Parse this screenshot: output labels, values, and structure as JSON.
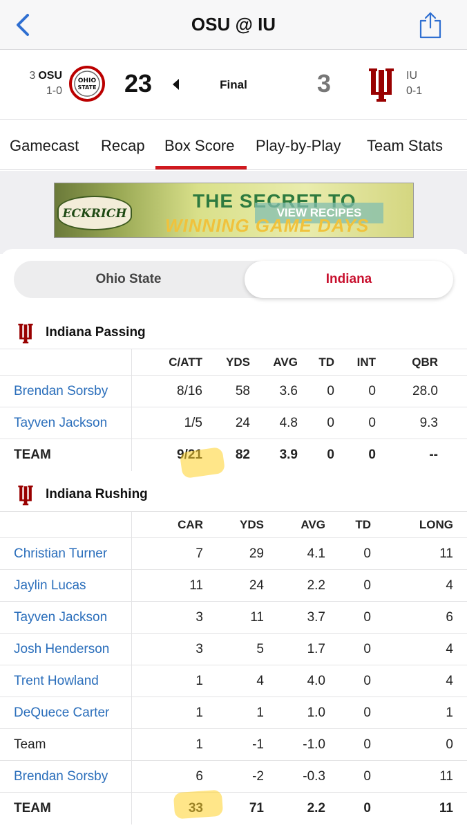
{
  "nav": {
    "title": "OSU @ IU",
    "back_icon": "chevron-left-icon",
    "share_icon": "share-icon"
  },
  "scoreboard": {
    "away": {
      "rank": "3",
      "abbr": "OSU",
      "record": "1-0",
      "score": "23",
      "logo_text": "OHIO STATE"
    },
    "status": "Final",
    "home": {
      "abbr": "IU",
      "record": "0-1",
      "score": "3"
    }
  },
  "tabs": [
    "Gamecast",
    "Recap",
    "Box Score",
    "Play-by-Play",
    "Team Stats"
  ],
  "active_tab": "Box Score",
  "ad": {
    "brand": "ECKRICH",
    "line1": "THE SECRET TO",
    "button": "VIEW RECIPES",
    "line2": "WINNING GAME DAYS"
  },
  "team_toggle": {
    "left": "Ohio State",
    "right": "Indiana",
    "selected": "Indiana"
  },
  "passing": {
    "title": "Indiana Passing",
    "headers": [
      "C/ATT",
      "YDS",
      "AVG",
      "TD",
      "INT",
      "QBR"
    ],
    "rows": [
      {
        "name": "Brendan Sorsby",
        "cells": [
          "8/16",
          "58",
          "3.6",
          "0",
          "0",
          "28.0"
        ]
      },
      {
        "name": "Tayven Jackson",
        "cells": [
          "1/5",
          "24",
          "4.8",
          "0",
          "0",
          "9.3"
        ]
      }
    ],
    "team": {
      "name": "TEAM",
      "cells": [
        "9/21",
        "82",
        "3.9",
        "0",
        "0",
        "--"
      ]
    }
  },
  "rushing": {
    "title": "Indiana Rushing",
    "headers": [
      "CAR",
      "YDS",
      "AVG",
      "TD",
      "LONG"
    ],
    "rows": [
      {
        "name": "Christian Turner",
        "cells": [
          "7",
          "29",
          "4.1",
          "0",
          "11"
        ]
      },
      {
        "name": "Jaylin Lucas",
        "cells": [
          "11",
          "24",
          "2.2",
          "0",
          "4"
        ]
      },
      {
        "name": "Tayven Jackson",
        "cells": [
          "3",
          "11",
          "3.7",
          "0",
          "6"
        ]
      },
      {
        "name": "Josh Henderson",
        "cells": [
          "3",
          "5",
          "1.7",
          "0",
          "4"
        ]
      },
      {
        "name": "Trent Howland",
        "cells": [
          "1",
          "4",
          "4.0",
          "0",
          "4"
        ]
      },
      {
        "name": "DeQuece Carter",
        "cells": [
          "1",
          "1",
          "1.0",
          "0",
          "1"
        ]
      },
      {
        "name": "Team",
        "cells": [
          "1",
          "-1",
          "-1.0",
          "0",
          "0"
        ]
      },
      {
        "name": "Brendan Sorsby",
        "cells": [
          "6",
          "-2",
          "-0.3",
          "0",
          "11"
        ]
      }
    ],
    "team": {
      "name": "TEAM",
      "cells": [
        "33",
        "71",
        "2.2",
        "0",
        "11"
      ]
    }
  },
  "colors": {
    "iu_crimson": "#990000",
    "accent_red": "#d0191f",
    "link_blue": "#2a6ebb",
    "highlight": "#ffd228"
  }
}
